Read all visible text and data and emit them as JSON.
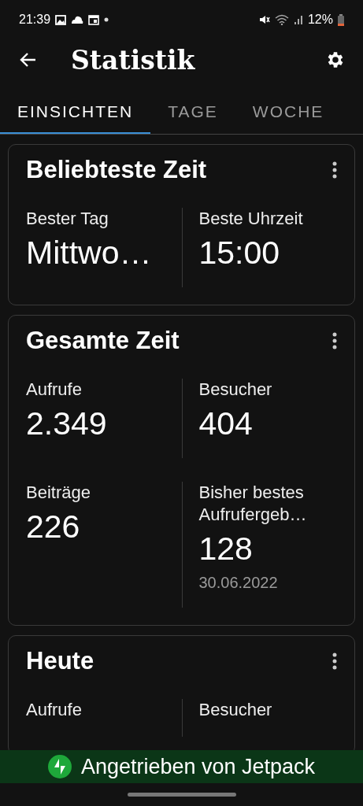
{
  "status_bar": {
    "time": "21:39",
    "battery": "12%"
  },
  "app_bar": {
    "title": "Statistik"
  },
  "tabs": [
    {
      "label": "EINSICHTEN",
      "selected": true
    },
    {
      "label": "TAGE",
      "selected": false
    },
    {
      "label": "WOCHE",
      "selected": false
    }
  ],
  "cards": [
    {
      "title": "Beliebteste Zeit",
      "rows": [
        [
          {
            "label": "Bester Tag",
            "value": "Mittwo…"
          },
          {
            "label": "Beste Uhrzeit",
            "value": "15:00"
          }
        ]
      ]
    },
    {
      "title": "Gesamte Zeit",
      "rows": [
        [
          {
            "label": "Aufrufe",
            "value": "2.349"
          },
          {
            "label": "Besucher",
            "value": "404"
          }
        ],
        [
          {
            "label": "Beiträge",
            "value": "226"
          },
          {
            "label": "Bisher bestes Aufrufergeb…",
            "value": "128",
            "note": "30.06.2022"
          }
        ]
      ]
    },
    {
      "title": "Heute",
      "rows": [
        [
          {
            "label": "Aufrufe"
          },
          {
            "label": "Besucher"
          }
        ]
      ]
    }
  ],
  "banner": {
    "text": "Angetrieben von Jetpack"
  }
}
